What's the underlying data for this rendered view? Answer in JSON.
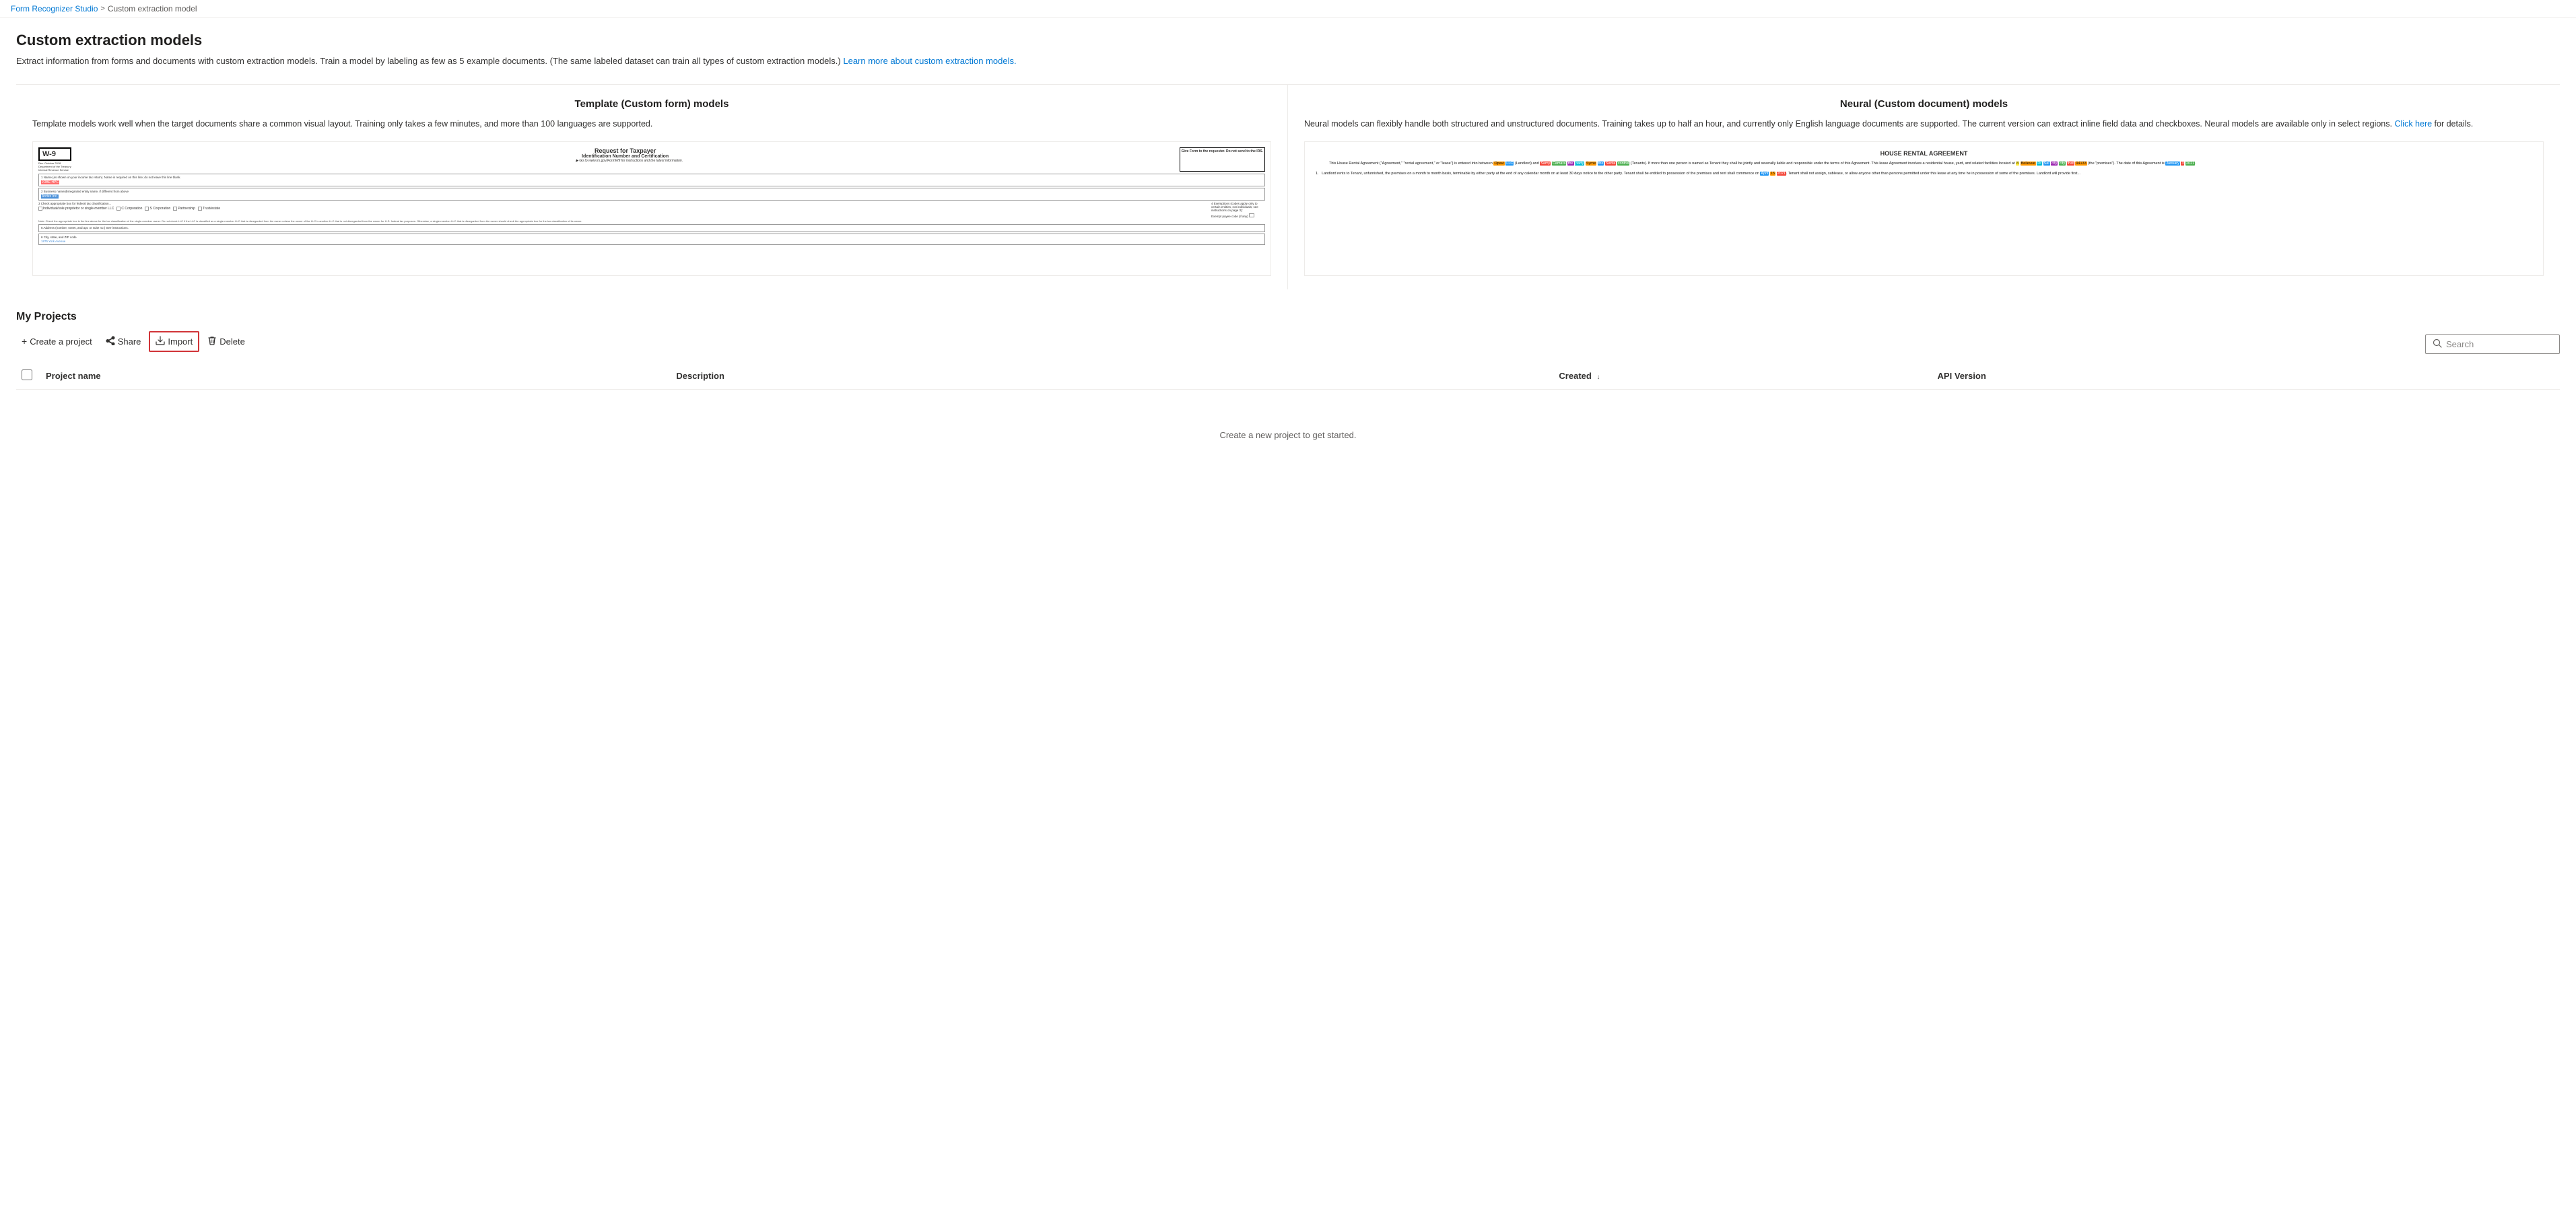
{
  "breadcrumb": {
    "home_label": "Form Recognizer Studio",
    "current_label": "Custom extraction model",
    "separator": ">"
  },
  "page": {
    "title": "Custom extraction models",
    "description": "Extract information from forms and documents with custom extraction models. Train a model by labeling as few as 5 example documents. (The same labeled dataset can train all types of custom extraction models.)",
    "learn_more_text": "Learn more about custom extraction models.",
    "learn_more_href": "#"
  },
  "models": {
    "template": {
      "title": "Template (Custom form) models",
      "description": "Template models work well when the target documents share a common visual layout. Training only takes a few minutes, and more than 100 languages are supported.",
      "preview_alt": "W-9 form preview with labeled fields"
    },
    "neural": {
      "title": "Neural (Custom document) models",
      "description": "Neural models can flexibly handle both structured and unstructured documents. Training takes up to half an hour, and currently only English language documents are supported. The current version can extract inline field data and checkboxes. Neural models are available only in select regions.",
      "click_here_text": "Click here",
      "for_details": "for details.",
      "preview_alt": "House rental agreement with highlighted fields"
    }
  },
  "my_projects": {
    "title": "My Projects",
    "toolbar": {
      "create_label": "Create a project",
      "share_label": "Share",
      "import_label": "Import",
      "delete_label": "Delete"
    },
    "table": {
      "columns": [
        {
          "key": "name",
          "label": "Project name"
        },
        {
          "key": "description",
          "label": "Description"
        },
        {
          "key": "created",
          "label": "Created",
          "sortable": true,
          "sort_direction": "desc"
        },
        {
          "key": "api_version",
          "label": "API Version"
        }
      ],
      "rows": [],
      "empty_state": "Create a new project to get started."
    },
    "search": {
      "placeholder": "Search",
      "value": ""
    }
  }
}
